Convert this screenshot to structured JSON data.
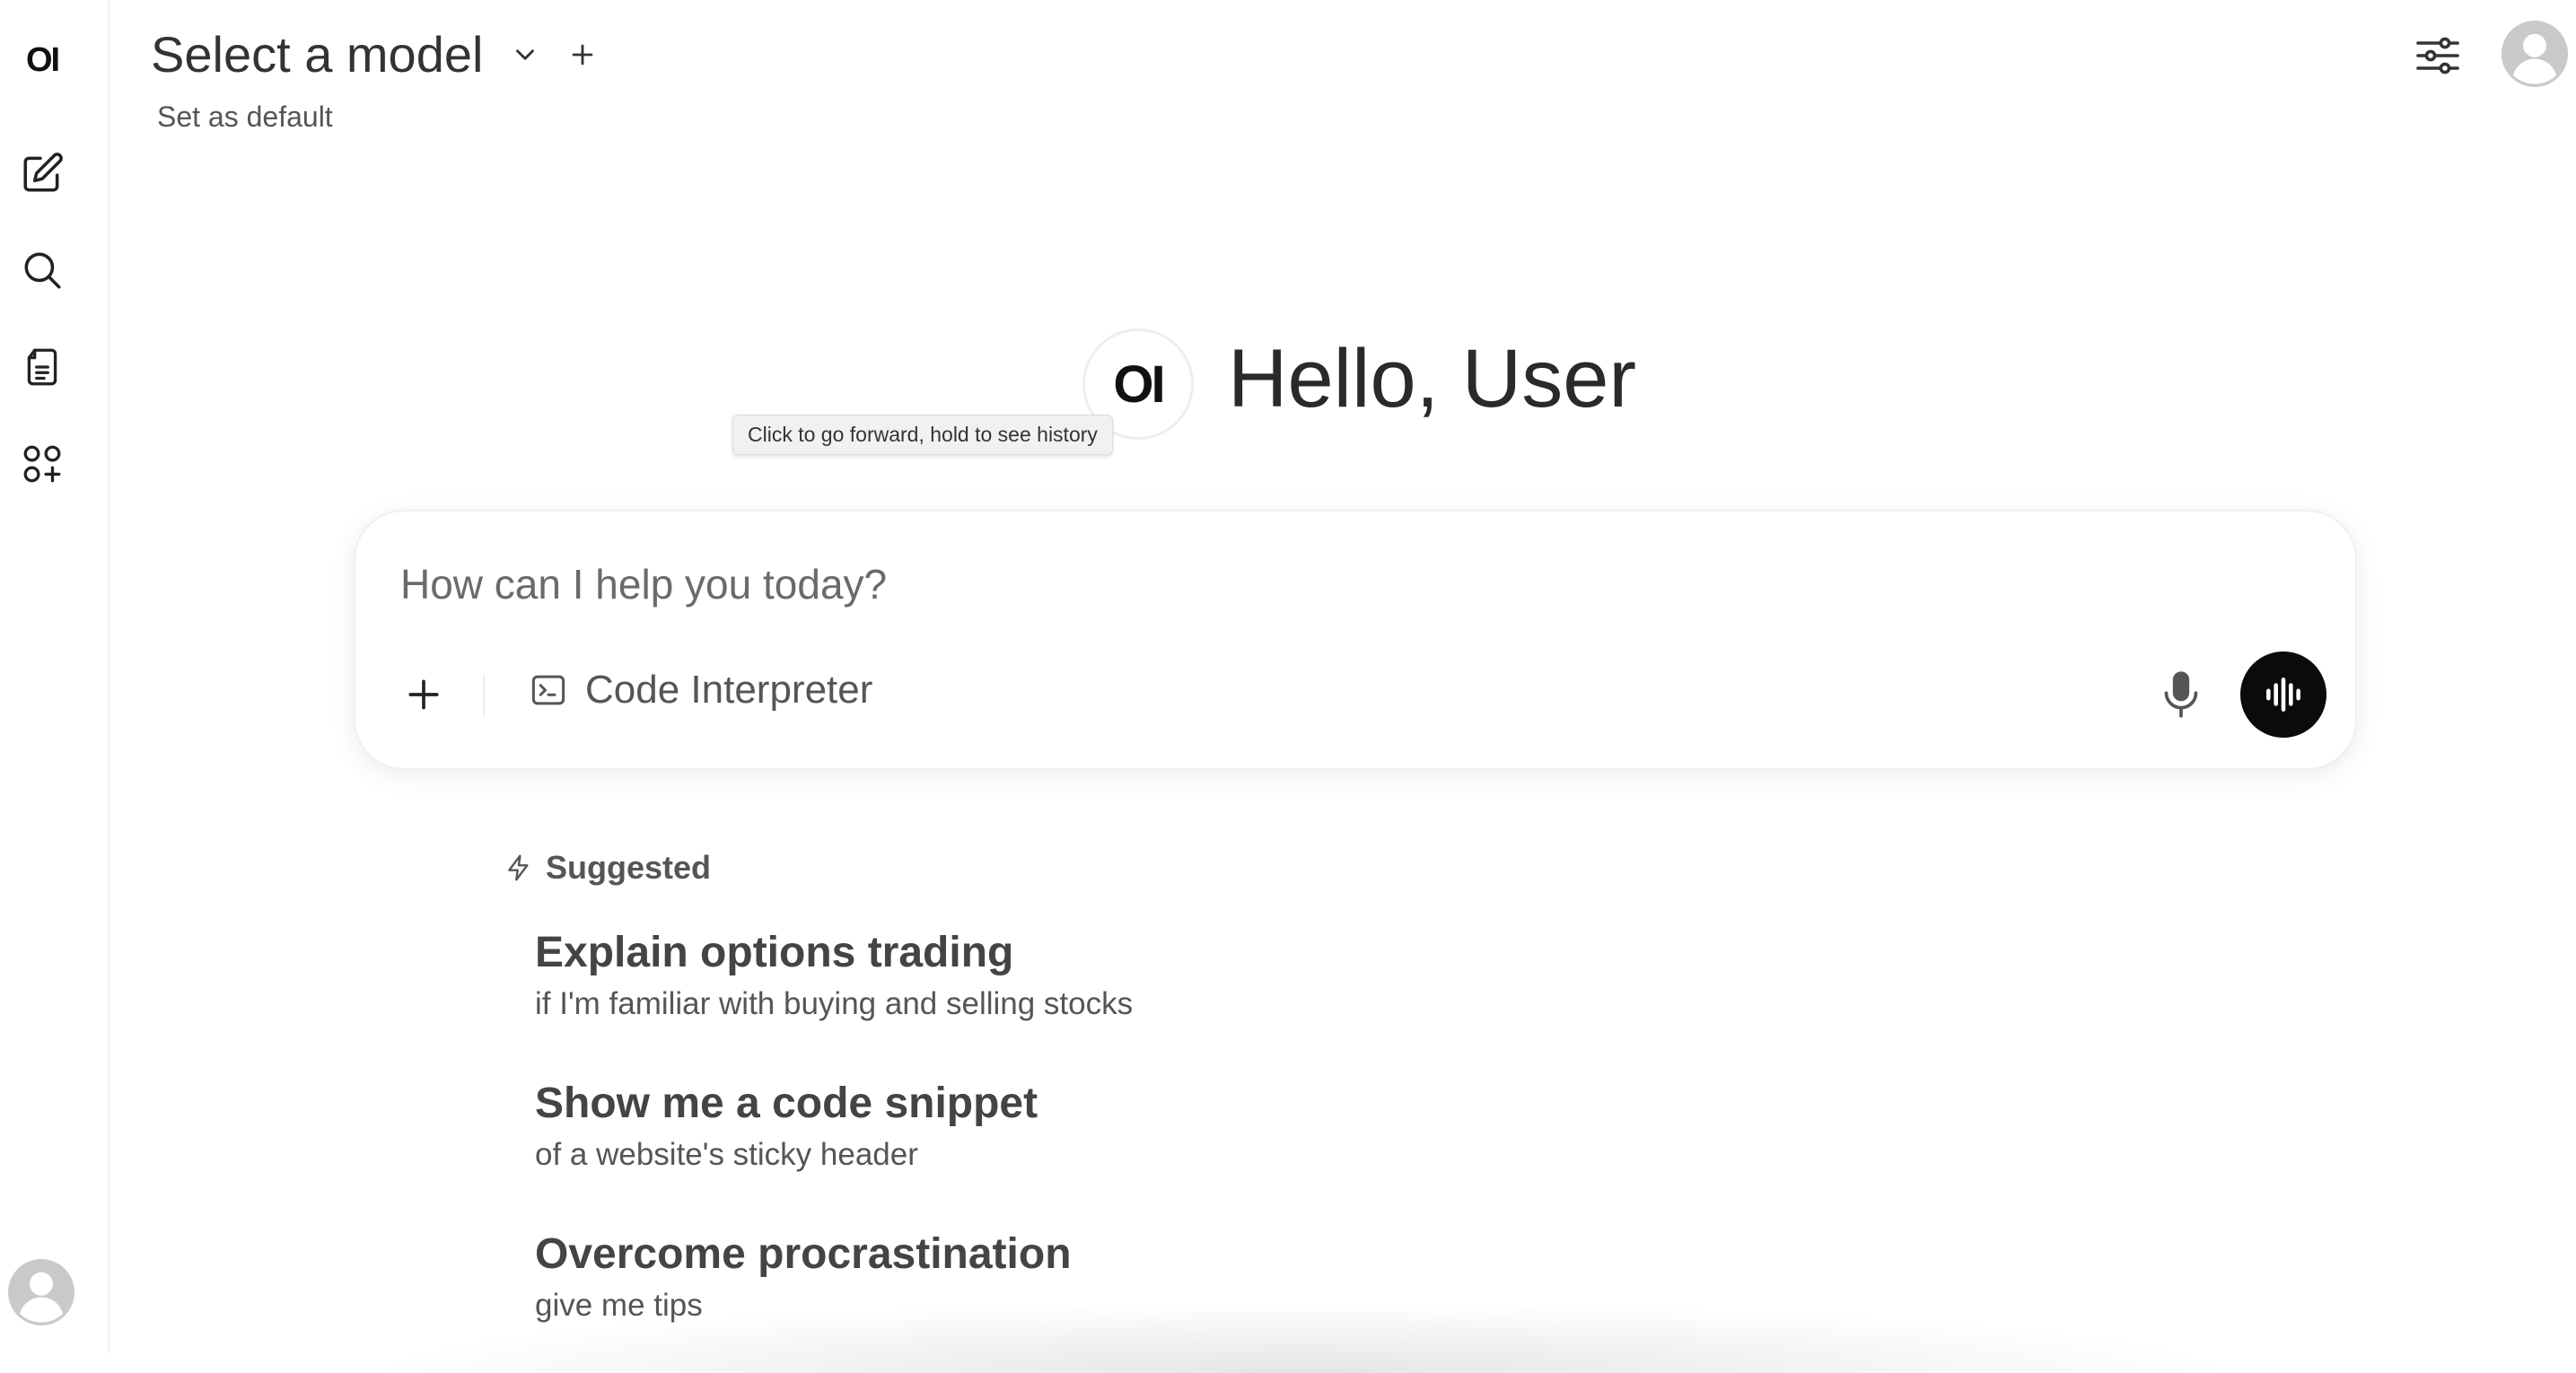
{
  "sidebar": {
    "logo_text": "OI",
    "items": [
      {
        "icon": "new-chat-icon"
      },
      {
        "icon": "search-icon"
      },
      {
        "icon": "notes-icon"
      },
      {
        "icon": "workspace-icon"
      }
    ],
    "user_avatar": "avatar-icon"
  },
  "header": {
    "model_title": "Select a model",
    "set_default": "Set as default",
    "controls_icon": "sliders-icon",
    "avatar_icon": "avatar-icon"
  },
  "greeting": {
    "logo_text": "OI",
    "text": "Hello, User",
    "tooltip": "Click to go forward, hold to see history"
  },
  "composer": {
    "placeholder": "How can I help you today?",
    "tool_label": "Code Interpreter"
  },
  "suggested": {
    "heading": "Suggested",
    "items": [
      {
        "title": "Explain options trading",
        "subtitle": "if I'm familiar with buying and selling stocks"
      },
      {
        "title": "Show me a code snippet",
        "subtitle": "of a website's sticky header"
      },
      {
        "title": "Overcome procrastination",
        "subtitle": "give me tips"
      }
    ]
  }
}
